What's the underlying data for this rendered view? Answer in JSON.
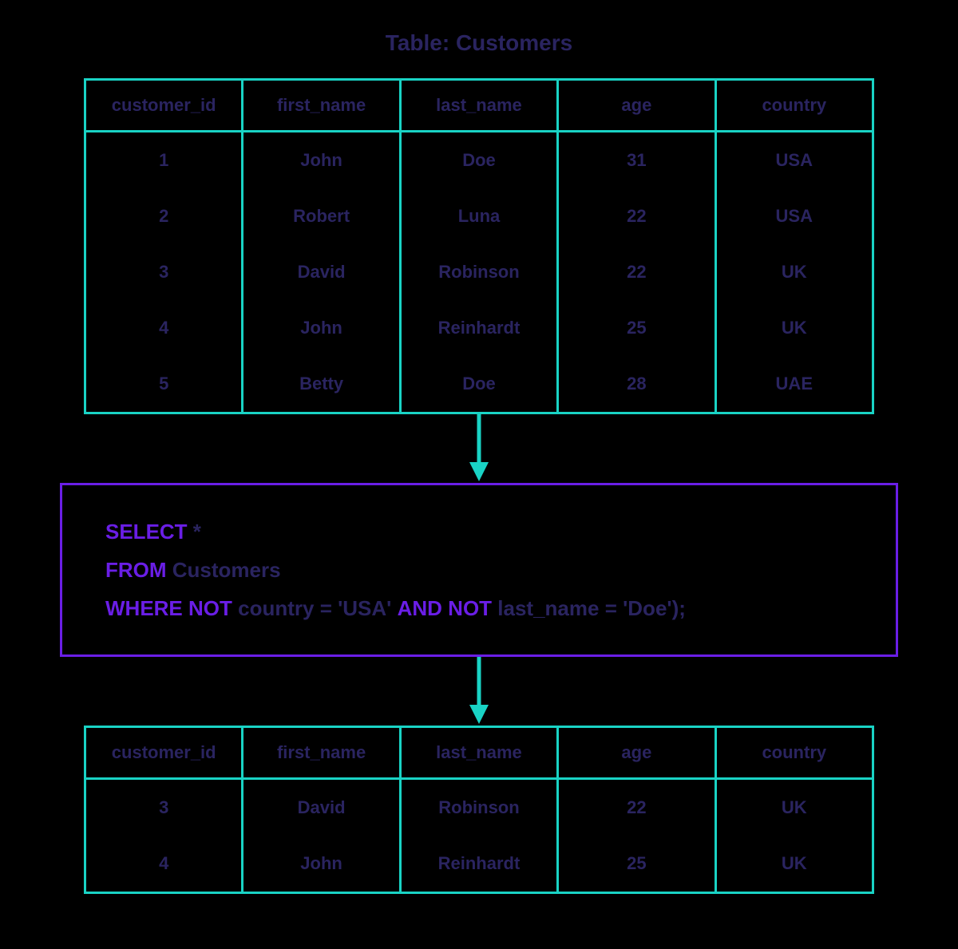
{
  "title": "Table: Customers",
  "columns": [
    "customer_id",
    "first_name",
    "last_name",
    "age",
    "country"
  ],
  "source_rows": [
    [
      "1",
      "John",
      "Doe",
      "31",
      "USA"
    ],
    [
      "2",
      "Robert",
      "Luna",
      "22",
      "USA"
    ],
    [
      "3",
      "David",
      "Robinson",
      "22",
      "UK"
    ],
    [
      "4",
      "John",
      "Reinhardt",
      "25",
      "UK"
    ],
    [
      "5",
      "Betty",
      "Doe",
      "28",
      "UAE"
    ]
  ],
  "result_rows": [
    [
      "3",
      "David",
      "Robinson",
      "22",
      "UK"
    ],
    [
      "4",
      "John",
      "Reinhardt",
      "25",
      "UK"
    ]
  ],
  "sql": {
    "select_kw": "SELECT",
    "select_rest": " *",
    "from_kw": "FROM",
    "from_rest": " Customers",
    "where_kw": "WHERE",
    "not1_kw": "NOT",
    "cond1": " country = 'USA' ",
    "and_kw": "AND",
    "not2_kw": "NOT",
    "cond2": " last_name = 'Doe');"
  },
  "colors": {
    "teal": "#19d3c5",
    "purple": "#6a1ee6",
    "navy": "#2a2460"
  }
}
